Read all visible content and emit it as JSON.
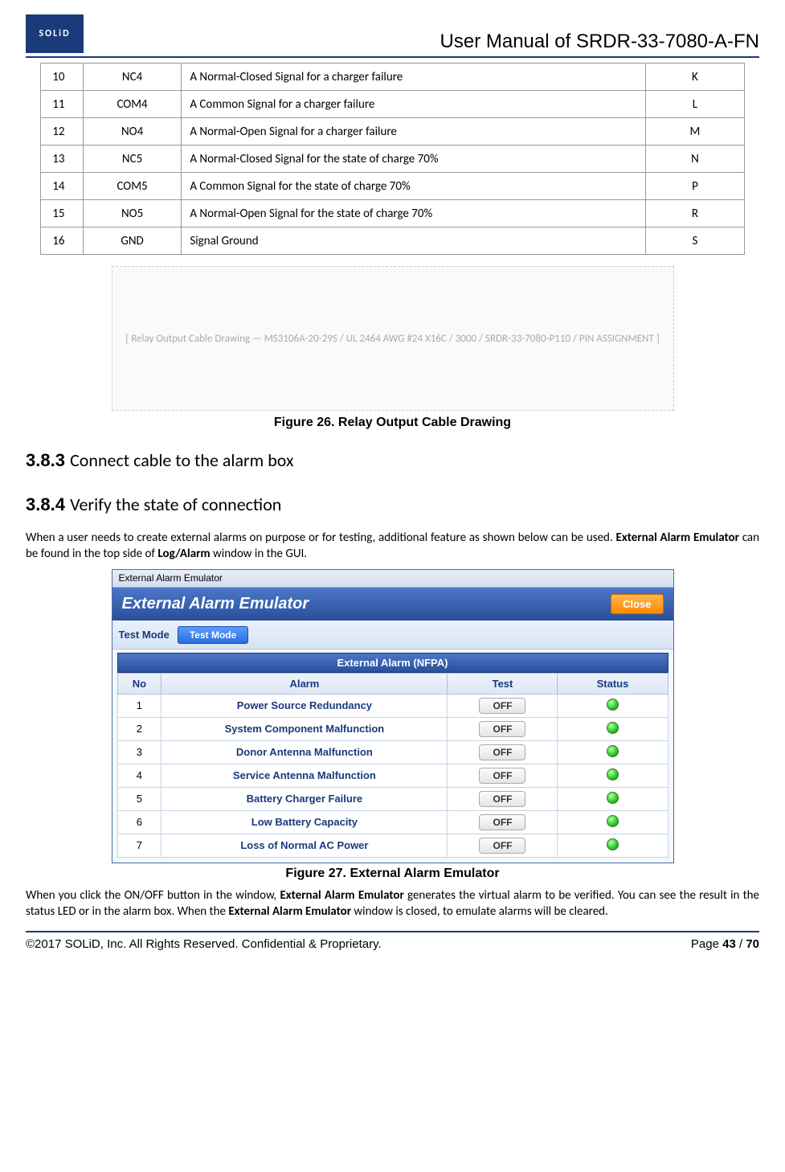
{
  "header": {
    "logo_text": "SOLiD",
    "doc_title": "User Manual of SRDR-33-7080-A-FN"
  },
  "pin_table": {
    "rows": [
      {
        "no": "10",
        "pin": "NC4",
        "desc": "A Normal-Closed Signal for a charger failure",
        "code": "K"
      },
      {
        "no": "11",
        "pin": "COM4",
        "desc": "A Common Signal for a charger failure",
        "code": "L"
      },
      {
        "no": "12",
        "pin": "NO4",
        "desc": "A Normal-Open Signal for a charger failure",
        "code": "M"
      },
      {
        "no": "13",
        "pin": "NC5",
        "desc": "A Normal-Closed Signal for the state of charge 70%",
        "code": "N"
      },
      {
        "no": "14",
        "pin": "COM5",
        "desc": "A Common Signal for the state of charge 70%",
        "code": "P"
      },
      {
        "no": "15",
        "pin": "NO5",
        "desc": "A Normal-Open Signal for the state of charge 70%",
        "code": "R"
      },
      {
        "no": "16",
        "pin": "GND",
        "desc": "Signal Ground",
        "code": "S"
      }
    ]
  },
  "figure26": {
    "placeholder": "[ Relay Output Cable Drawing — MS3106A-20-29S / UL 2464 AWG #24 X16C / 3000 / SRDR-33-7080-P110 / PIN ASSIGNMENT ]",
    "caption": "Figure 26. Relay Output Cable Drawing"
  },
  "section383": {
    "num": "3.8.3",
    "title": "Connect cable to the alarm box"
  },
  "section384": {
    "num": "3.8.4",
    "title": "Verify the state of connection"
  },
  "para1": {
    "pre": "When a user needs to create external alarms on purpose or for testing, additional feature as shown below can be used. ",
    "b1": "External Alarm Emulator",
    "mid": " can be found in the top side of ",
    "b2": "Log/Alarm",
    "post": " window in the GUI."
  },
  "emulator": {
    "win_title": "External Alarm Emulator",
    "header_title": "External Alarm Emulator",
    "close": "Close",
    "mode_label": "Test Mode",
    "mode_button": "Test Mode",
    "section_title": "External Alarm (NFPA)",
    "cols": {
      "no": "No",
      "alarm": "Alarm",
      "test": "Test",
      "status": "Status"
    },
    "rows": [
      {
        "no": "1",
        "alarm": "Power Source Redundancy",
        "test": "OFF"
      },
      {
        "no": "2",
        "alarm": "System Component Malfunction",
        "test": "OFF"
      },
      {
        "no": "3",
        "alarm": "Donor Antenna Malfunction",
        "test": "OFF"
      },
      {
        "no": "4",
        "alarm": "Service Antenna Malfunction",
        "test": "OFF"
      },
      {
        "no": "5",
        "alarm": "Battery Charger Failure",
        "test": "OFF"
      },
      {
        "no": "6",
        "alarm": "Low Battery Capacity",
        "test": "OFF"
      },
      {
        "no": "7",
        "alarm": "Loss of Normal AC Power",
        "test": "OFF"
      }
    ]
  },
  "figure27": {
    "caption": "Figure 27. External Alarm Emulator"
  },
  "para2": {
    "pre": "When you click the ON/OFF button in the window, ",
    "b1": "External Alarm Emulator",
    "mid": " generates the virtual alarm to be verified. You can see the result in the status LED or in the alarm box. When the ",
    "b2": "External Alarm Emulator",
    "post": " window is closed, to emulate alarms will be cleared."
  },
  "footer": {
    "copyright": "©2017 SOLiD, Inc. All Rights Reserved. Confidential & Proprietary.",
    "page_label": "Page ",
    "page_cur": "43",
    "page_sep": " / ",
    "page_total": "70"
  }
}
